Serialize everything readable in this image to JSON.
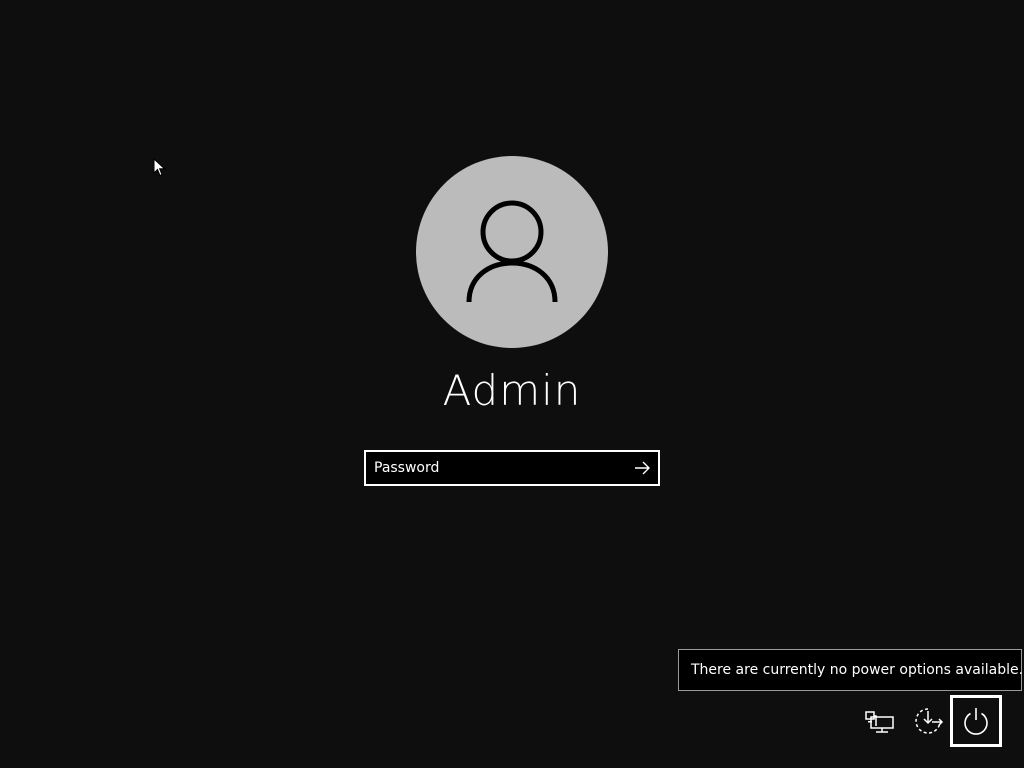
{
  "login": {
    "username": "Admin",
    "password_placeholder": "Password",
    "submit_icon": "arrow-right-icon"
  },
  "avatar": {
    "icon": "user-icon",
    "background": "#bbbbbb"
  },
  "tray": {
    "network_icon": "network-icon",
    "ease_of_access_icon": "ease-of-access-icon",
    "power_icon": "power-icon"
  },
  "tooltip": {
    "text": "There are currently no power options available."
  },
  "colors": {
    "background": "#0e0e0e",
    "foreground": "#ffffff",
    "tooltip_border": "#9a9a9a"
  }
}
